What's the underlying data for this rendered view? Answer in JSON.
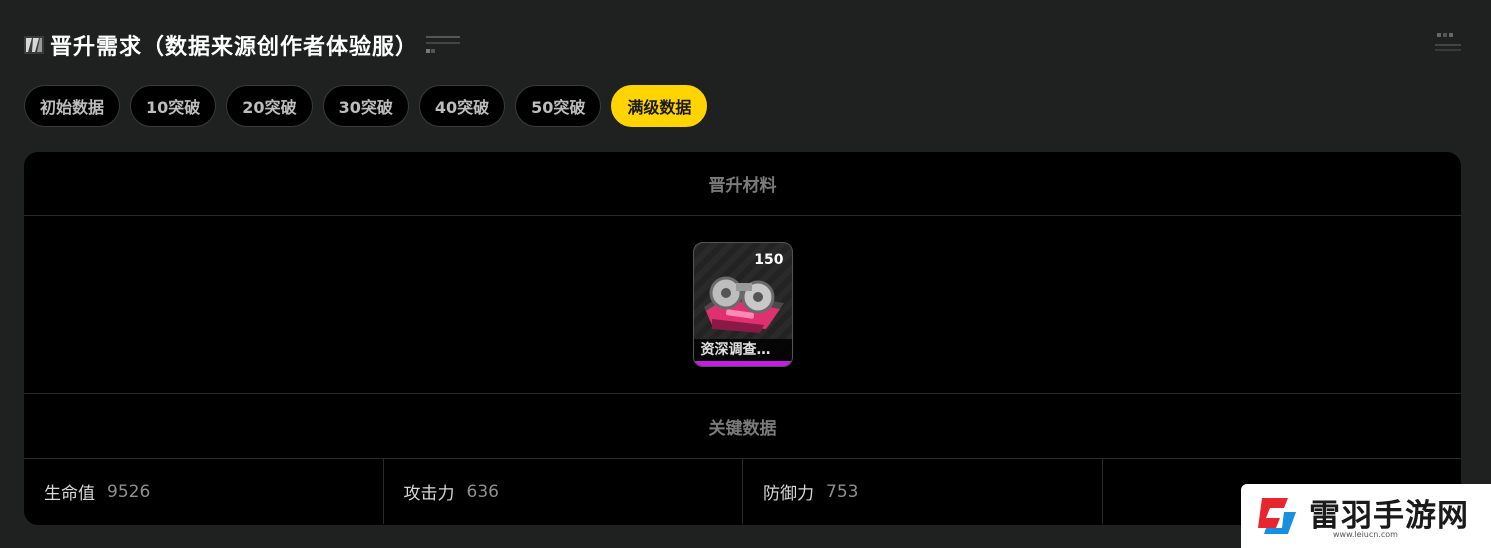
{
  "header": {
    "title": "晋升需求（数据来源创作者体验服）"
  },
  "tabs": [
    {
      "label": "初始数据",
      "active": false
    },
    {
      "label": "10突破",
      "active": false
    },
    {
      "label": "20突破",
      "active": false
    },
    {
      "label": "30突破",
      "active": false
    },
    {
      "label": "40突破",
      "active": false
    },
    {
      "label": "50突破",
      "active": false
    },
    {
      "label": "满级数据",
      "active": true
    }
  ],
  "materials_section": {
    "heading": "晋升材料",
    "items": [
      {
        "name": "资深调查…",
        "count": "150",
        "icon": "tape-recorder-icon",
        "rarity_color": "#c31fe0"
      }
    ]
  },
  "stats_section": {
    "heading": "关键数据",
    "stats": [
      {
        "label": "生命值",
        "value": "9526"
      },
      {
        "label": "攻击力",
        "value": "636"
      },
      {
        "label": "防御力",
        "value": "753"
      },
      {
        "label": "",
        "value": ""
      }
    ]
  },
  "watermark": {
    "name": "雷羽手游网",
    "url": "www.leiucn.com"
  },
  "colors": {
    "background": "#1f2020",
    "panel": "#000000",
    "active_tab": "#ffd400",
    "rarity": "#c31fe0"
  }
}
